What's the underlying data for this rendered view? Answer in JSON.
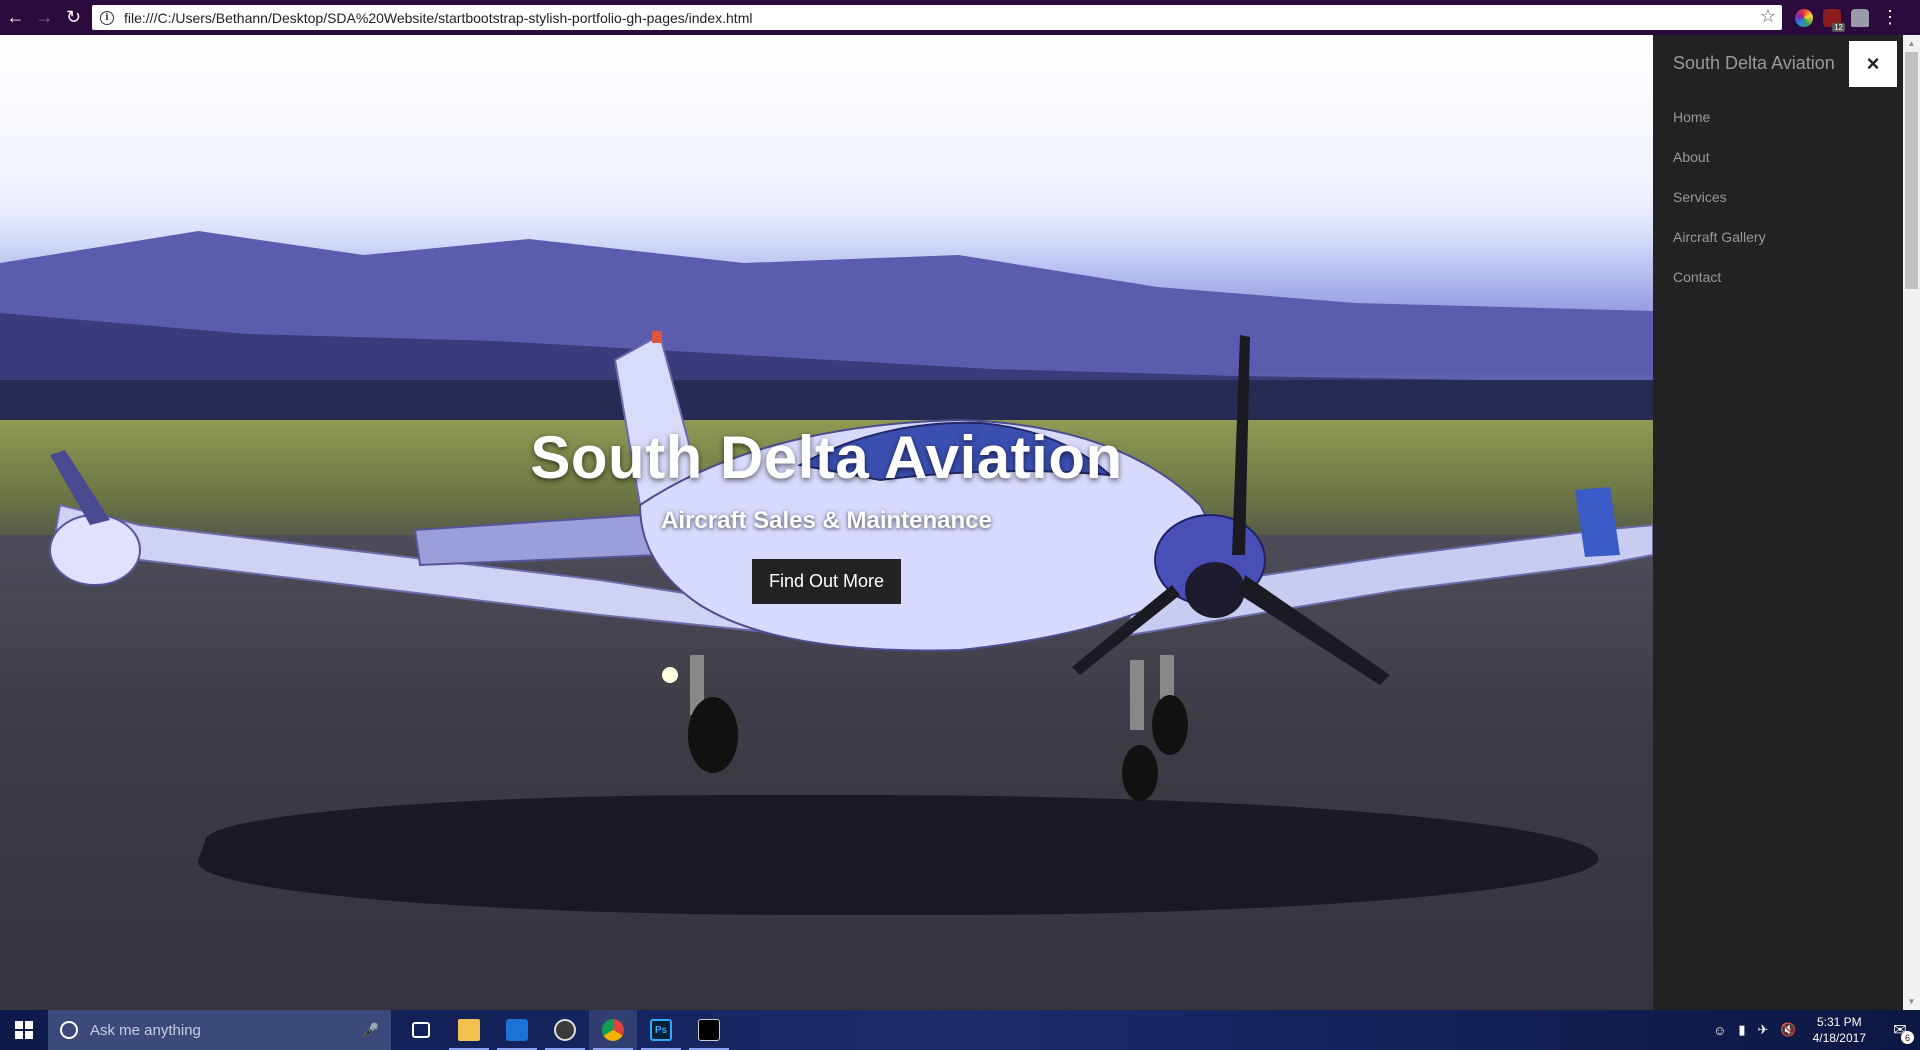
{
  "browser": {
    "url": "file:///C:/Users/Bethann/Desktop/SDA%20Website/startbootstrap-stylish-portfolio-gh-pages/index.html",
    "icons": [
      "back-icon",
      "forward-icon",
      "reload-icon",
      "info-icon",
      "star-icon",
      "color-extension-icon",
      "ublock-icon",
      "ghostery-icon",
      "menu-icon"
    ],
    "ublock_badge": "12"
  },
  "hero": {
    "title": "South Delta Aviation",
    "subtitle": "Aircraft Sales & Maintenance",
    "cta_label": "Find Out More"
  },
  "sidebar": {
    "brand": "South Delta Aviation",
    "close_icon": "×",
    "items": [
      {
        "label": "Home"
      },
      {
        "label": "About"
      },
      {
        "label": "Services"
      },
      {
        "label": "Aircraft Gallery"
      },
      {
        "label": "Contact"
      }
    ]
  },
  "taskbar": {
    "search_placeholder": "Ask me anything",
    "apps": [
      "task-view",
      "file-explorer",
      "app",
      "app",
      "chrome",
      "photoshop",
      "command-prompt"
    ],
    "clock_time": "5:31 PM",
    "clock_date": "4/18/2017",
    "notification_count": "6"
  },
  "colors": {
    "sidebar_bg": "#222222",
    "sidebar_text": "#999999",
    "browser_bar": "#2b0a3d",
    "taskbar": "#1b2b6a"
  }
}
